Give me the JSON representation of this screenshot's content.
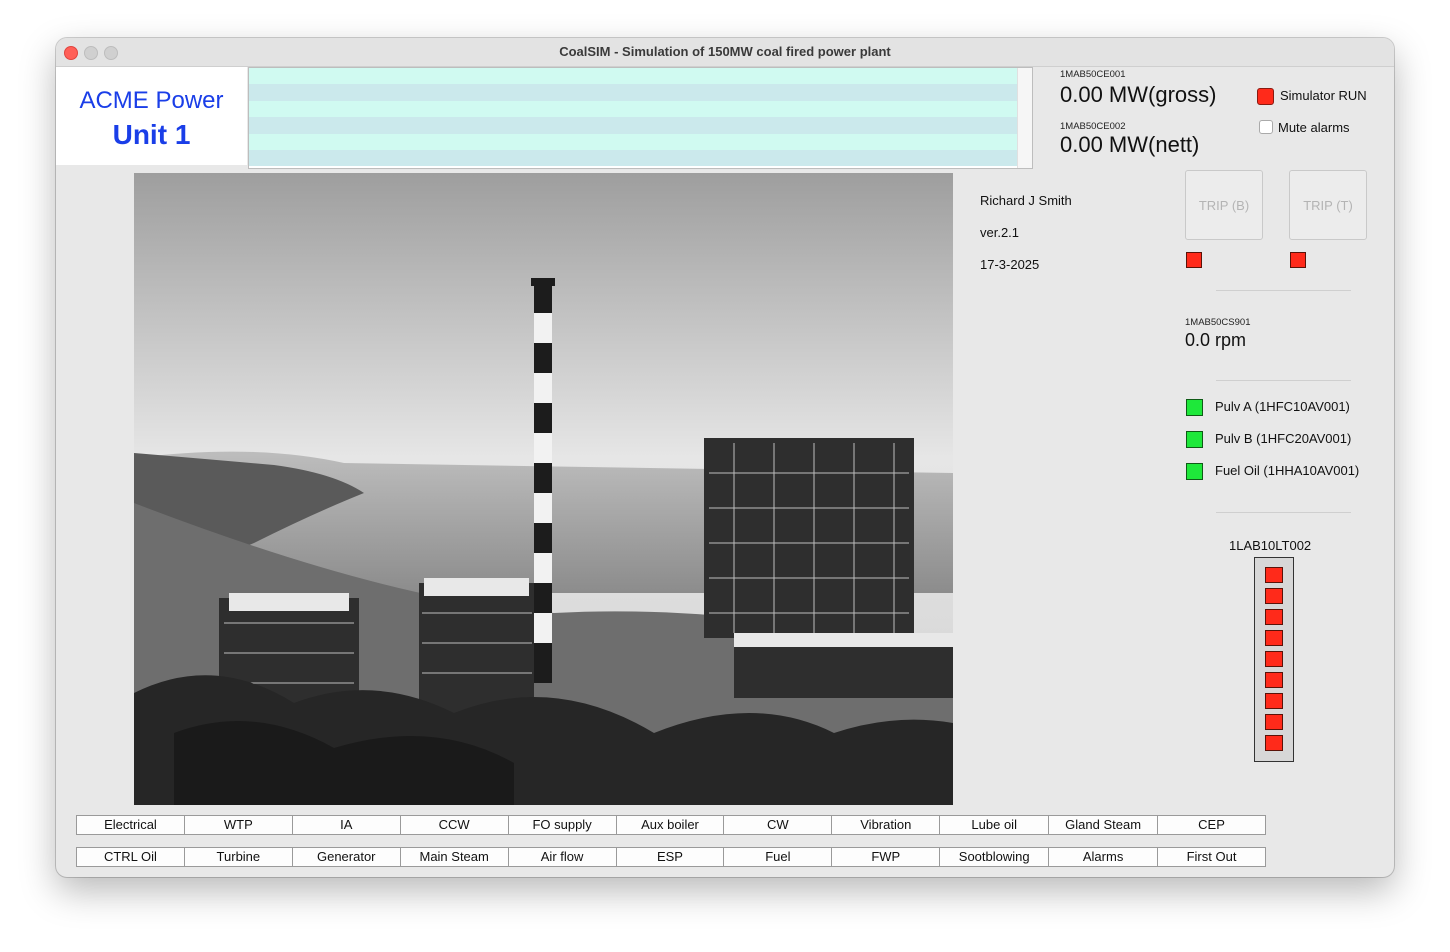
{
  "window": {
    "title": "CoalSIM - Simulation of 150MW coal fired power plant"
  },
  "brand": {
    "company": "ACME Power",
    "unit": "Unit 1"
  },
  "readouts": {
    "gross": {
      "tag": "1MAB50CE001",
      "value": "0.00 MW(gross)"
    },
    "nett": {
      "tag": "1MAB50CE002",
      "value": "0.00 MW(nett)"
    },
    "speed": {
      "tag": "1MAB50CS901",
      "value": "0.0 rpm"
    }
  },
  "controls": {
    "simulator_run": {
      "label": "Simulator RUN",
      "checked": true,
      "color": "#ff2a1a"
    },
    "mute_alarms": {
      "label": "Mute alarms",
      "checked": false
    }
  },
  "info": {
    "author": "Richard J Smith",
    "version": "ver.2.1",
    "date": "17-3-2025"
  },
  "trips": [
    {
      "label": "TRIP (B)",
      "indicator_color": "#ff2a1a"
    },
    {
      "label": "TRIP (T)",
      "indicator_color": "#ff2a1a"
    }
  ],
  "status_indicators": [
    {
      "label": "Pulv A (1HFC10AV001)",
      "color": "#1ee83a"
    },
    {
      "label": "Pulv B (1HFC20AV001)",
      "color": "#1ee83a"
    },
    {
      "label": "Fuel Oil (1HHA10AV001)",
      "color": "#1ee83a"
    }
  ],
  "level": {
    "tag": "1LAB10LT002",
    "cells": 9,
    "color": "#ff2a1a"
  },
  "nav_row1": [
    "Electrical",
    "WTP",
    "IA",
    "CCW",
    "FO supply",
    "Aux boiler",
    "CW",
    "Vibration",
    "Lube oil",
    "Gland Steam",
    "CEP"
  ],
  "nav_row2": [
    "CTRL Oil",
    "Turbine",
    "Generator",
    "Main Steam",
    "Air flow",
    "ESP",
    "Fuel",
    "FWP",
    "Sootblowing",
    "Alarms",
    "First Out"
  ],
  "colors": {
    "brand_blue": "#1a3ee8",
    "alarm_odd": "#d0faf1",
    "alarm_even": "#cbe9ec"
  }
}
